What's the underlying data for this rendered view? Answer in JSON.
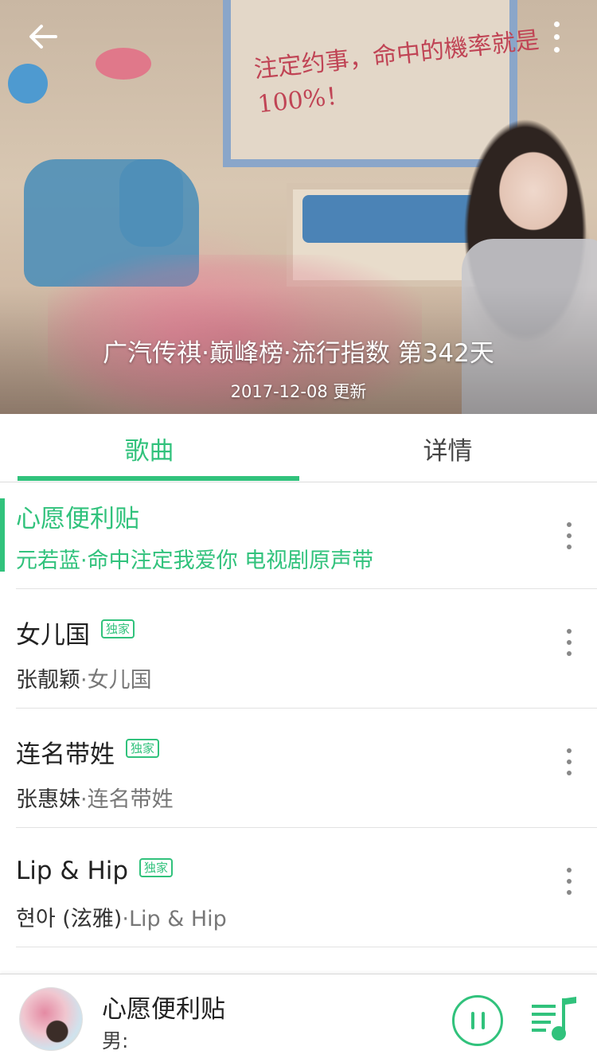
{
  "header": {
    "chart_title": "广汽传祺·巅峰榜·流行指数 第342天",
    "updated": "2017-12-08 更新",
    "cover_caption": "注定约事，命中的機率就是100%！"
  },
  "tabs": [
    {
      "label": "歌曲",
      "active": true
    },
    {
      "label": "详情",
      "active": false
    }
  ],
  "songs": [
    {
      "title": "心愿便利贴",
      "artist": "元若蓝",
      "album": "命中注定我爱你 电视剧原声带",
      "badge": "",
      "playing": true
    },
    {
      "title": "女儿国",
      "artist": "张靓颖",
      "album": "女儿国",
      "badge": "独家",
      "playing": false
    },
    {
      "title": "连名带姓",
      "artist": "张惠妹",
      "album": "连名带姓",
      "badge": "独家",
      "playing": false
    },
    {
      "title": "Lip & Hip",
      "artist": "현아 (泫雅)",
      "album": "Lip & Hip",
      "badge": "独家",
      "playing": false
    }
  ],
  "partial_song": "next-song-title-clipped",
  "player": {
    "title": "心愿便利贴",
    "subtitle": "男:",
    "state": "playing"
  },
  "colors": {
    "accent": "#31c27c",
    "text": "#222222",
    "secondary_text": "#777777",
    "divider": "#e2e2e2"
  }
}
